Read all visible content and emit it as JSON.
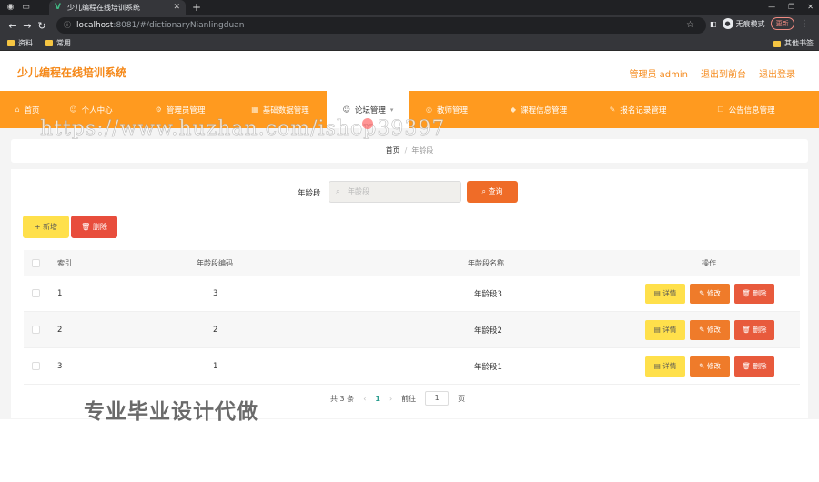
{
  "browser": {
    "tab_title": "少儿编程在线培训系统",
    "tab_favicon": "V",
    "new_tab": "+",
    "window_controls": [
      "—",
      "❐",
      "✕"
    ],
    "url_host": "localhost",
    "url_path": ":8081/#/dictionaryNianlingduan",
    "incognito_label": "无痕模式",
    "update_label": "更新",
    "bookmarks": [
      "资料",
      "常用"
    ],
    "other_bookmarks": "其他书签"
  },
  "header": {
    "title": "少儿编程在线培训系统",
    "admin_label": "管理员 admin",
    "front_link": "退出到前台",
    "logout_link": "退出登录"
  },
  "nav": {
    "items": [
      {
        "label": "首页",
        "icon": "home-icon"
      },
      {
        "label": "个人中心",
        "icon": "user-icon"
      },
      {
        "label": "管理员管理",
        "icon": "admin-icon"
      },
      {
        "label": "基础数据管理",
        "icon": "data-icon"
      },
      {
        "label": "论坛管理",
        "icon": "forum-icon"
      },
      {
        "label": "教师管理",
        "icon": "teacher-icon"
      },
      {
        "label": "课程信息管理",
        "icon": "course-icon"
      },
      {
        "label": "报名记录管理",
        "icon": "record-icon"
      },
      {
        "label": "公告信息管理",
        "icon": "notice-icon"
      }
    ],
    "active_index": 4
  },
  "watermark_url": "https://www.huzhan.com/ishop39397",
  "watermark_cn": "专业毕业设计代做",
  "breadcrumb": {
    "home": "首页",
    "separator": "/",
    "current": "年龄段"
  },
  "search": {
    "label": "年龄段",
    "placeholder": "年龄段",
    "button": "查询"
  },
  "toolbar": {
    "add": "新增",
    "delete": "删除"
  },
  "table": {
    "headers": {
      "index": "索引",
      "code": "年龄段编码",
      "name": "年龄段名称",
      "ops": "操作"
    },
    "rows": [
      {
        "index": "1",
        "code": "3",
        "name": "年龄段3"
      },
      {
        "index": "2",
        "code": "2",
        "name": "年龄段2"
      },
      {
        "index": "3",
        "code": "1",
        "name": "年龄段1"
      }
    ],
    "op_labels": {
      "detail": "详情",
      "edit": "修改",
      "remove": "删除"
    }
  },
  "pager": {
    "total": "共 3 条",
    "prev": "‹",
    "current": "1",
    "next": "›",
    "goto_label": "前往",
    "goto_value": "1",
    "page_unit": "页"
  },
  "colors": {
    "accent": "#ff9a1f",
    "title": "#f5891a",
    "search_btn": "#ef6c28",
    "add_btn": "#ffe04b",
    "delete_btn": "#e84d3c"
  }
}
